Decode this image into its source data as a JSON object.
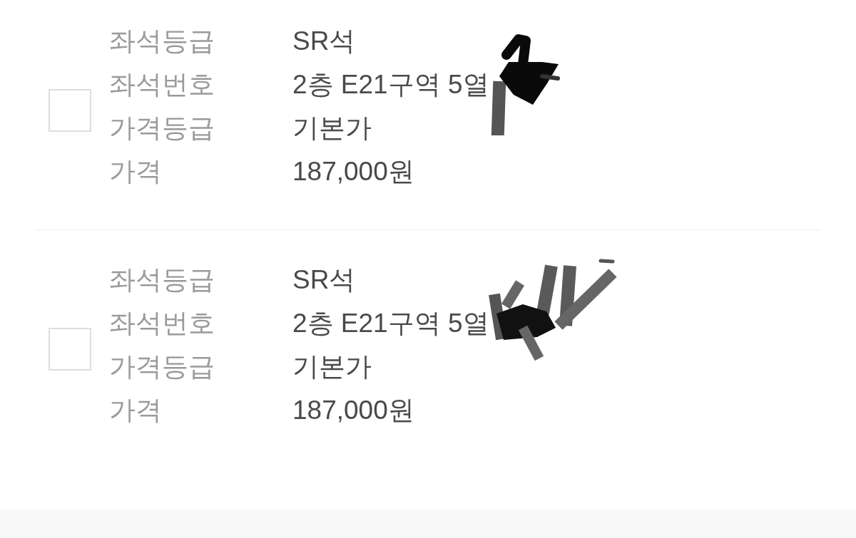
{
  "tickets": [
    {
      "checked": false,
      "fields": [
        {
          "label": "좌석등급",
          "value": "SR석",
          "redacted": false
        },
        {
          "label": "좌석번호",
          "value": "2층 E21구역 5열",
          "redacted": true
        },
        {
          "label": "가격등급",
          "value": "기본가",
          "redacted": false
        },
        {
          "label": "가격",
          "value": "187,000원",
          "redacted": false
        }
      ]
    },
    {
      "checked": false,
      "fields": [
        {
          "label": "좌석등급",
          "value": "SR석",
          "redacted": false
        },
        {
          "label": "좌석번호",
          "value": "2층 E21구역 5열",
          "redacted": true
        },
        {
          "label": "가격등급",
          "value": "기본가",
          "redacted": false
        },
        {
          "label": "가격",
          "value": "187,000원",
          "redacted": false
        }
      ]
    }
  ]
}
